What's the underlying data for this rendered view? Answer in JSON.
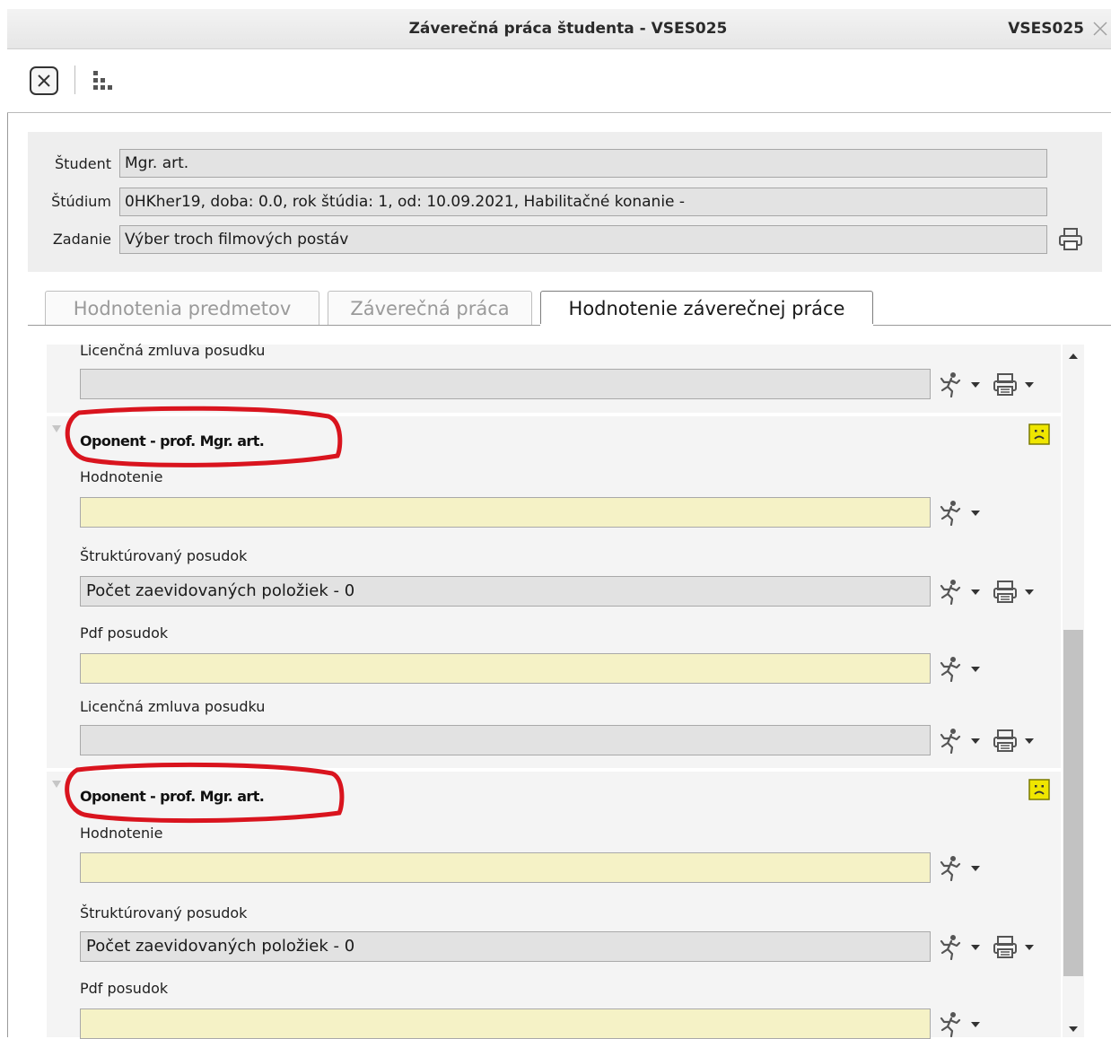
{
  "window": {
    "title": "Záverečná práca študenta - VSES025",
    "code": "VSES025"
  },
  "toolbar": {
    "close_icon": "close-square-icon",
    "tree_icon": "hierarchy-icon"
  },
  "header": {
    "student_label": "Študent",
    "student_value": "Mgr. art.",
    "study_label": "Štúdium",
    "study_value": "0HKher19, doba: 0.0, rok štúdia: 1, od: 10.09.2021, Habilitačné konanie -",
    "assignment_label": "Zadanie",
    "assignment_value": "Výber troch filmových postáv"
  },
  "tabs": [
    {
      "label": "Hodnotenia predmetov",
      "active": false
    },
    {
      "label": "Záverečná práca",
      "active": false
    },
    {
      "label": "Hodnotenie záverečnej práce",
      "active": true
    }
  ],
  "content": {
    "top_section": {
      "license_label": "Licenčná zmluva posudku",
      "license_value": ""
    },
    "sections": [
      {
        "title": "Oponent - prof. Mgr. art.",
        "evaluation_label": "Hodnotenie",
        "evaluation_value": "",
        "structured_label": "Štruktúrovaný posudok",
        "structured_value": "Počet zaevidovaných položiek - 0",
        "pdf_label": "Pdf posudok",
        "pdf_value": "",
        "license_label": "Licenčná zmluva posudku",
        "license_value": ""
      },
      {
        "title": "Oponent - prof. Mgr. art.",
        "evaluation_label": "Hodnotenie",
        "evaluation_value": "",
        "structured_label": "Štruktúrovaný posudok",
        "structured_value": "Počet zaevidovaných položiek - 0",
        "pdf_label": "Pdf posudok",
        "pdf_value": ""
      }
    ]
  },
  "colors": {
    "field_gray": "#e2e2e2",
    "field_yellow": "#f5f2c6",
    "annotation_red": "#d9141e",
    "sad_face": "#e8e000"
  }
}
